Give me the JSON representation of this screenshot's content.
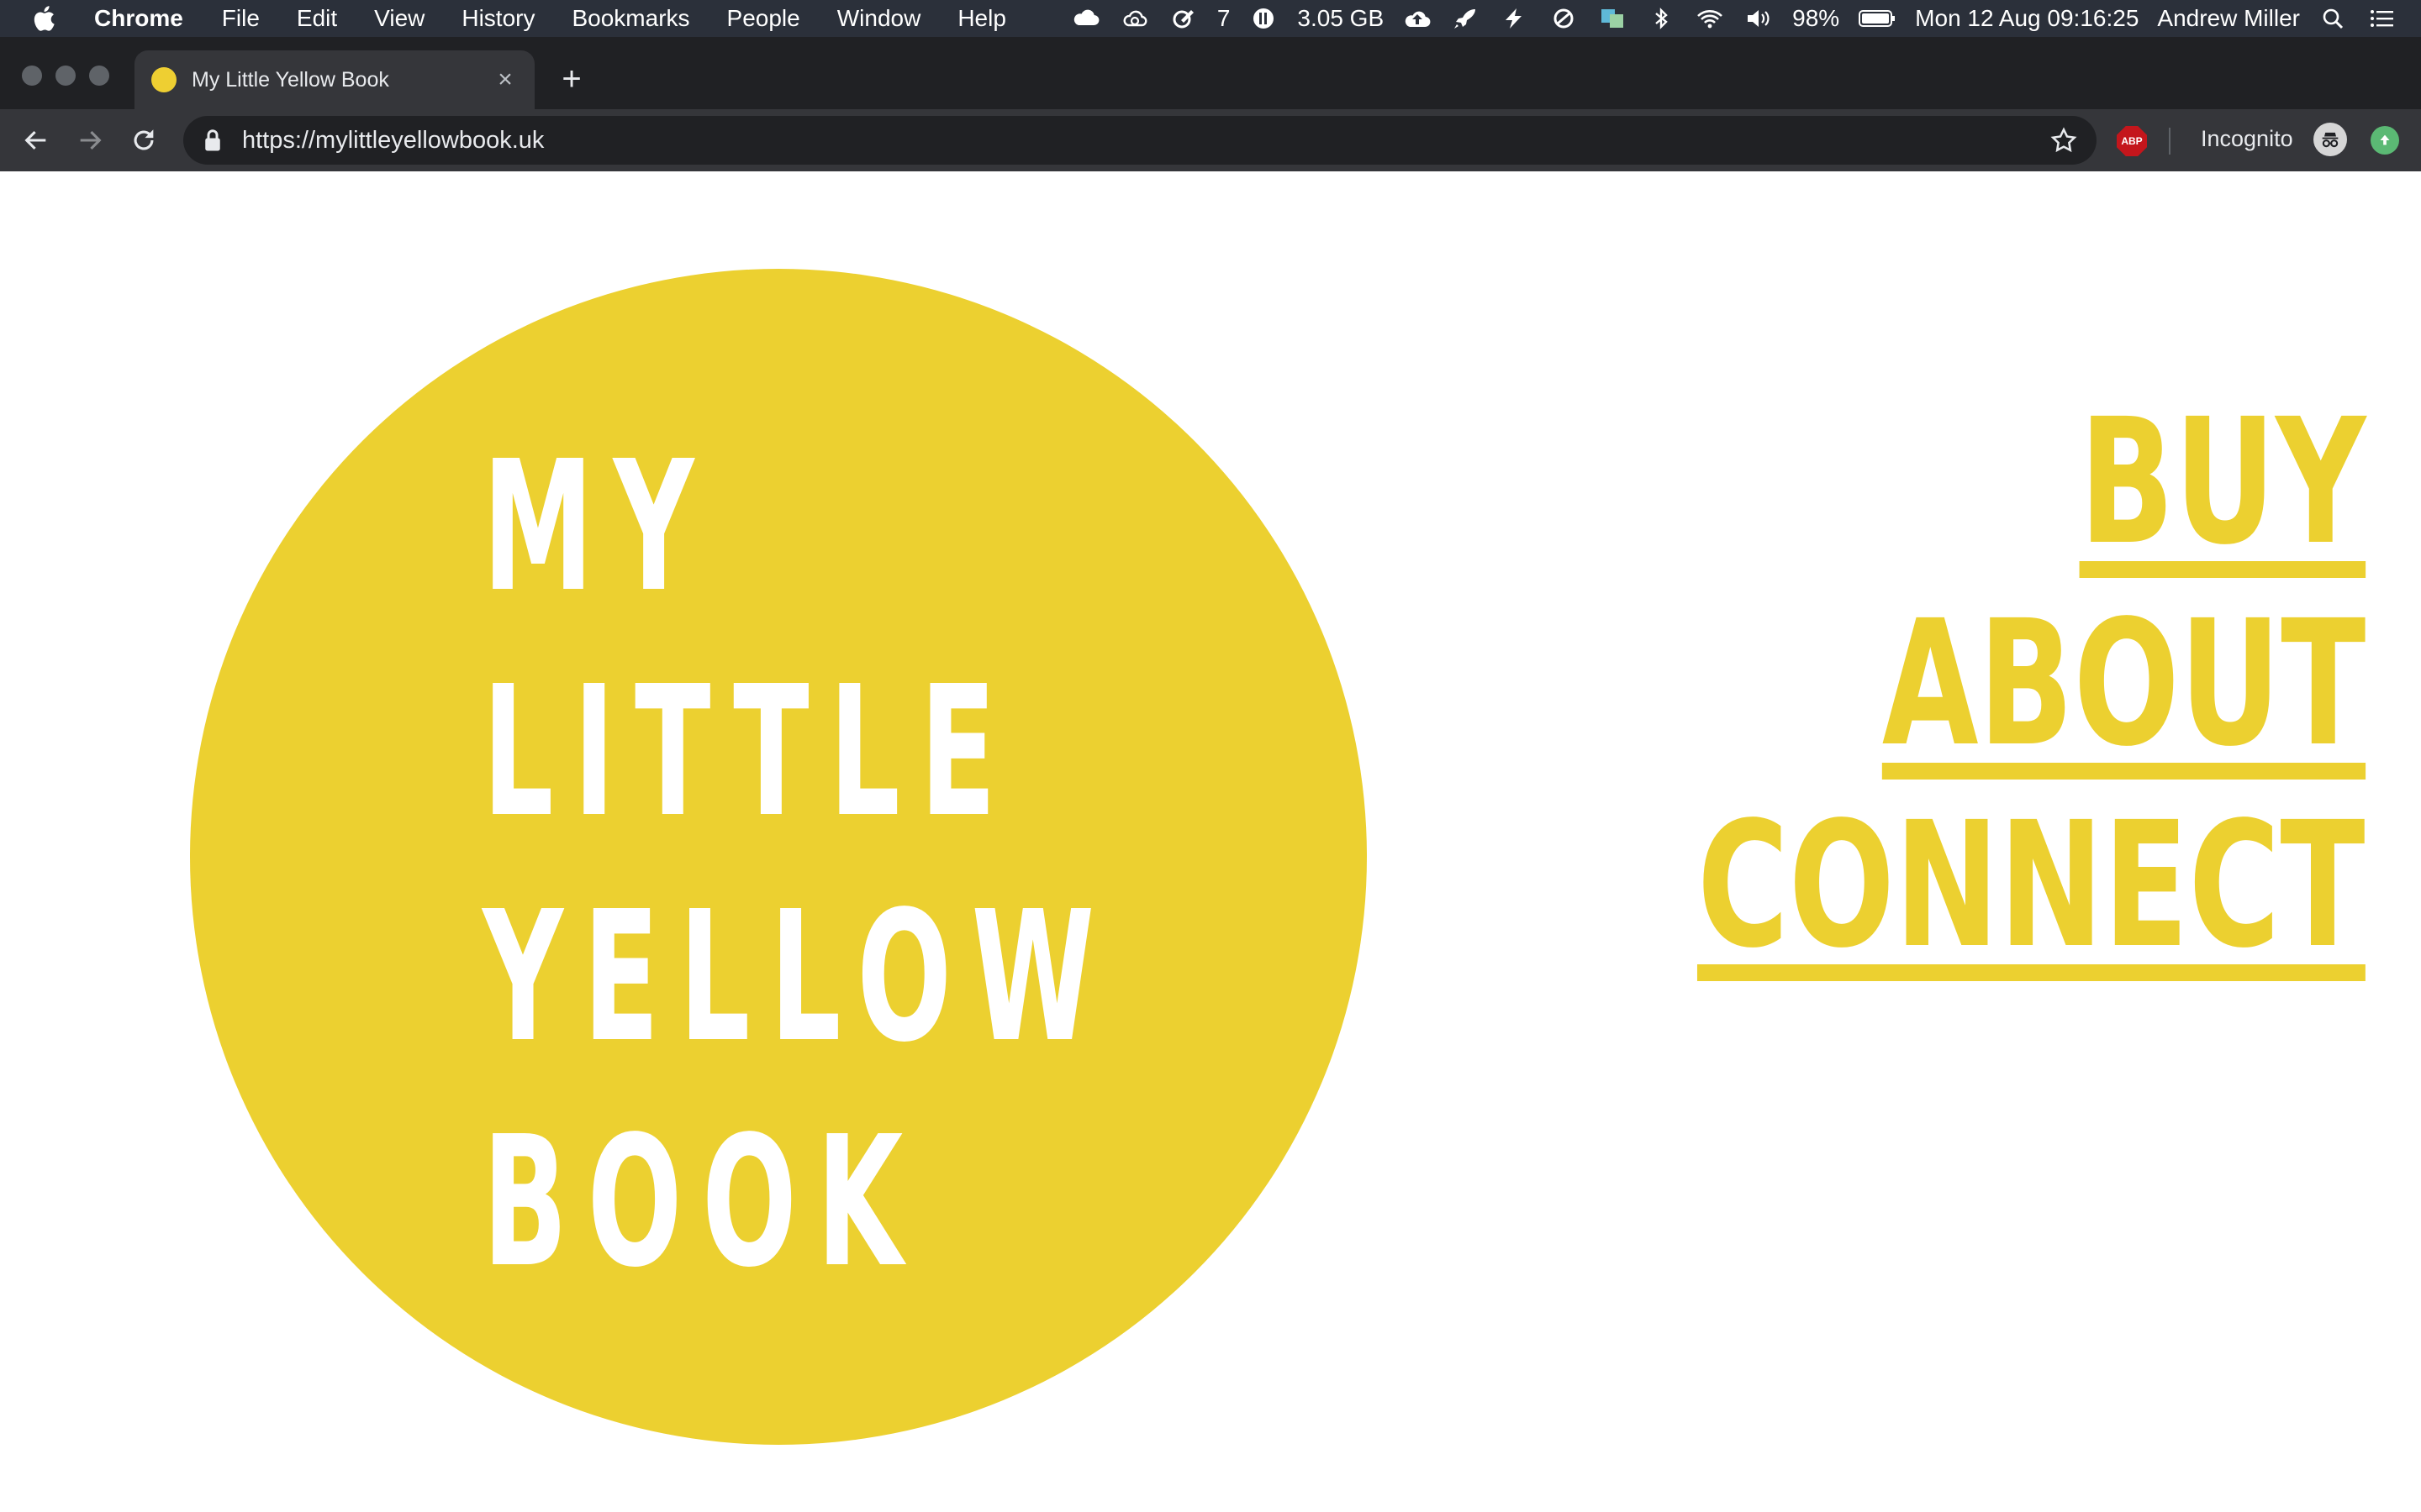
{
  "menubar": {
    "app_name": "Chrome",
    "menus": [
      "File",
      "Edit",
      "View",
      "History",
      "Bookmarks",
      "People",
      "Window",
      "Help"
    ],
    "status": {
      "sync_count": "7",
      "memory": "3.05 GB",
      "battery": "98%",
      "datetime": "Mon 12 Aug  09:16:25",
      "user": "Andrew Miller"
    }
  },
  "browser": {
    "tab_title": "My Little Yellow Book",
    "tab_close": "×",
    "new_tab": "+",
    "url": "https://mylittleyellowbook.uk",
    "incognito_label": "Incognito",
    "abp_label": "ABP"
  },
  "site": {
    "title_lines": [
      "MY",
      "LITTLE",
      "YELLOW",
      "BOOK"
    ],
    "nav": [
      "BUY",
      "ABOUT",
      "CONNECT"
    ],
    "brand_color": "#ecd030"
  }
}
